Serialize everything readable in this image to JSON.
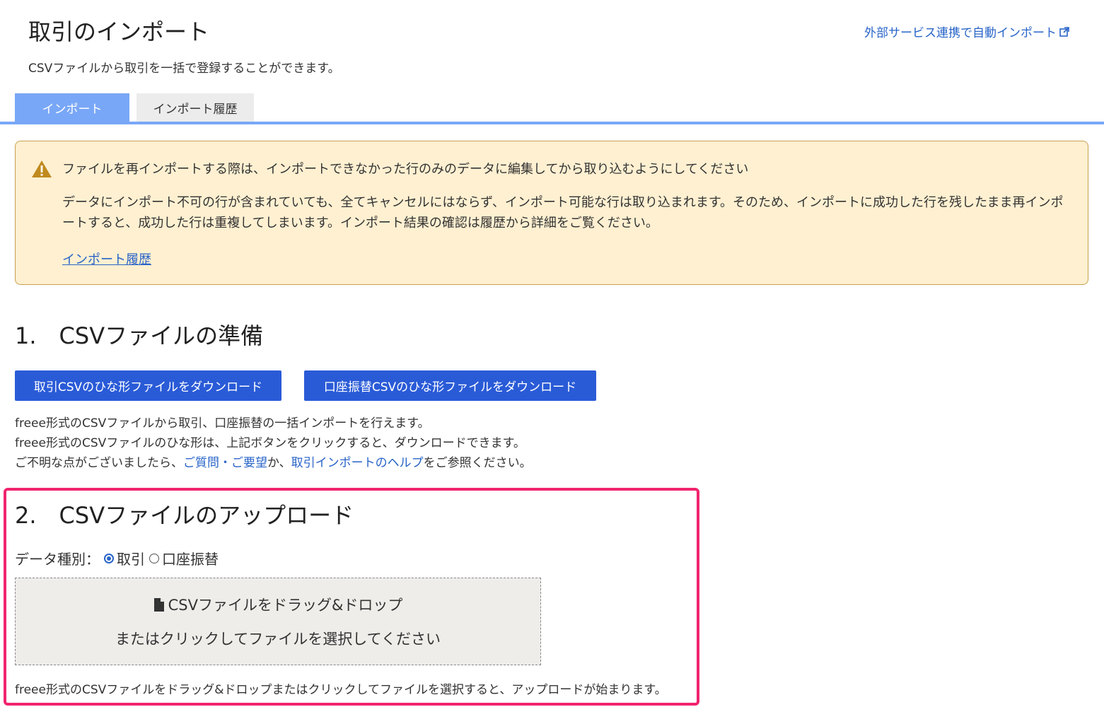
{
  "header": {
    "title": "取引のインポート",
    "subtitle": "CSVファイルから取引を一括で登録することができます。",
    "external_link": "外部サービス連携で自動インポート"
  },
  "tabs": [
    {
      "label": "インポート",
      "active": true
    },
    {
      "label": "インポート履歴",
      "active": false
    }
  ],
  "warning": {
    "title": "ファイルを再インポートする際は、インポートできなかった行のみのデータに編集してから取り込むようにしてください",
    "body": "データにインポート不可の行が含まれていても、全てキャンセルにはならず、インポート可能な行は取り込まれます。そのため、インポートに成功した行を残したまま再インポートすると、成功した行は重複してしまいます。インポート結果の確認は履歴から詳細をご覧ください。",
    "link": "インポート履歴"
  },
  "section1": {
    "heading": "1.　CSVファイルの準備",
    "button_deal": "取引CSVのひな形ファイルをダウンロード",
    "button_transfer": "口座振替CSVのひな形ファイルをダウンロード",
    "line1": "freee形式のCSVファイルから取引、口座振替の一括インポートを行えます。",
    "line2": "freee形式のCSVファイルのひな形は、上記ボタンをクリックすると、ダウンロードできます。",
    "line3_prefix": "ご不明な点がございましたら、",
    "line3_link1": "ご質問・ご要望",
    "line3_mid": "か、",
    "line3_link2": "取引インポートのヘルプ",
    "line3_suffix": "をご参照ください。"
  },
  "section2": {
    "heading": "2.　CSVファイルのアップロード",
    "data_type_label": "データ種別：",
    "option_deal": "取引",
    "option_transfer": "口座振替",
    "selected": "取引",
    "dropzone_line1": "CSVファイルをドラッグ&ドロップ",
    "dropzone_line2": "またはクリックしてファイルを選択してください",
    "note": "freee形式のCSVファイルをドラッグ&ドロップまたはクリックしてファイルを選択すると、アップロードが始まります。"
  },
  "colors": {
    "accent_blue": "#2a5bd7",
    "tab_blue": "#79a7f7",
    "link_blue": "#2864c8",
    "warning_bg": "#fff0d1",
    "highlight_pink": "#f0246e"
  },
  "icons": [
    "external-link-icon",
    "warning-icon",
    "file-icon"
  ]
}
